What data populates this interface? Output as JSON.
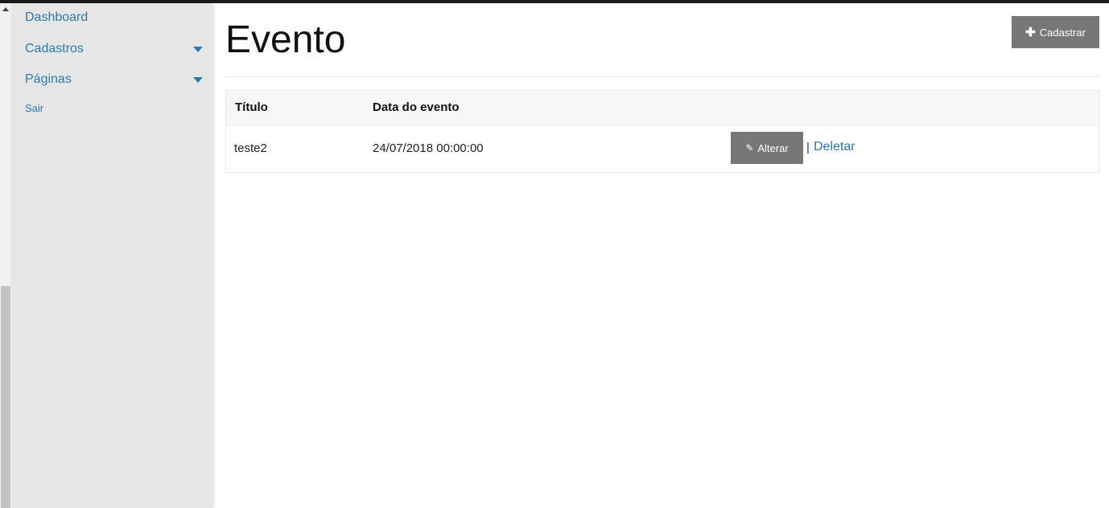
{
  "sidebar": {
    "items": [
      {
        "label": "Dashboard"
      },
      {
        "label": "Cadastros"
      },
      {
        "label": "Páginas"
      },
      {
        "label": "Sair"
      }
    ]
  },
  "page": {
    "title": "Evento",
    "add_button": "Cadastrar"
  },
  "table": {
    "headers": [
      "Título",
      "Data do evento"
    ],
    "rows": [
      {
        "titulo": "teste2",
        "data": "24/07/2018 00:00:00",
        "edit_label": "Alterar",
        "separator": "|",
        "delete_label": "Deletar"
      }
    ]
  },
  "colors": {
    "link": "#2a7ab0",
    "button": "#777777",
    "sidebar_bg": "#e6e6e6"
  }
}
